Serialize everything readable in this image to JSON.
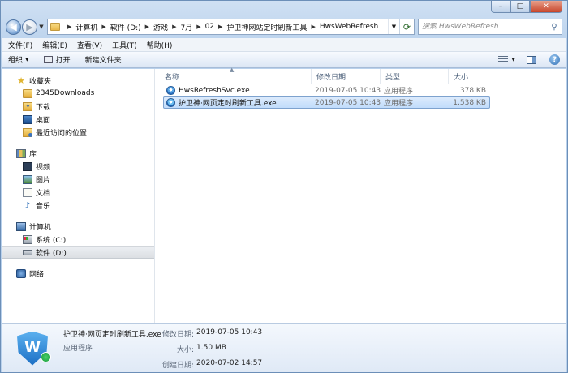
{
  "window": {
    "minimize_label": "–",
    "maximize_label": "□",
    "close_label": "✕"
  },
  "address_bar": {
    "crumbs": [
      "计算机",
      "软件 (D:)",
      "游戏",
      "7月",
      "02",
      "护卫神网站定时刷新工具",
      "HwsWebRefresh"
    ]
  },
  "search": {
    "placeholder": "搜索 HwsWebRefresh"
  },
  "menu": {
    "items": [
      "文件(F)",
      "编辑(E)",
      "查看(V)",
      "工具(T)",
      "帮助(H)"
    ]
  },
  "toolbar": {
    "organize_label": "组织",
    "open_label": "打开",
    "new_folder_label": "新建文件夹"
  },
  "nav": {
    "favorites": {
      "label": "收藏夹",
      "items": [
        "2345Downloads",
        "下载",
        "桌面",
        "最近访问的位置"
      ]
    },
    "libraries": {
      "label": "库",
      "items": [
        "视频",
        "图片",
        "文档",
        "音乐"
      ]
    },
    "computer": {
      "label": "计算机",
      "items": [
        "系统 (C:)",
        "软件 (D:)"
      ]
    },
    "network": {
      "label": "网络"
    }
  },
  "columns": {
    "name": "名称",
    "date": "修改日期",
    "type": "类型",
    "size": "大小"
  },
  "files": [
    {
      "name": "HwsRefreshSvc.exe",
      "date": "2019-07-05 10:43",
      "type": "应用程序",
      "size": "378 KB"
    },
    {
      "name": "护卫神·网页定时刷新工具.exe",
      "date": "2019-07-05 10:43",
      "type": "应用程序",
      "size": "1,538 KB"
    }
  ],
  "details": {
    "name": "护卫神·网页定时刷新工具.exe",
    "type": "应用程序",
    "modified_label": "修改日期:",
    "modified_value": "2019-07-05 10:43",
    "size_label": "大小:",
    "size_value": "1.50 MB",
    "created_label": "创建日期:",
    "created_value": "2020-07-02 14:57",
    "icon_letter": "W"
  }
}
